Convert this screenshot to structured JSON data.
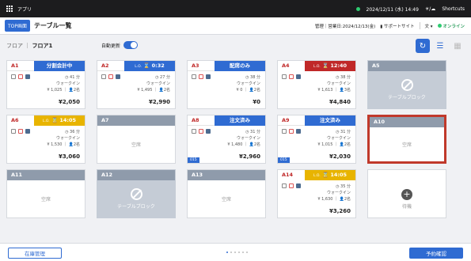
{
  "topbar": {
    "app": "アプリ",
    "datetime": "2024/12/11 (水) 14:49",
    "store": "Shortcuts"
  },
  "header": {
    "top_tag": "TOP画面",
    "title": "テーブル一覧",
    "business_date": "管理｜営業日:2024/12/13(金)",
    "support": "サポートサイト",
    "lang": "文",
    "status": "オンライン"
  },
  "toolbar": {
    "floor_label": "フロア",
    "floor_value": "フロア1",
    "auto_update": "自動更新"
  },
  "cards": [
    {
      "id": "A1",
      "status": "分割会計中",
      "type": "occ",
      "mins": "41",
      "entry": "ウォークイン",
      "sub": "¥ 1,025",
      "guests": "2",
      "total": "¥2,050"
    },
    {
      "id": "A2",
      "status": "0:32",
      "type": "occ",
      "lo": "L.O.",
      "mins": "27",
      "entry": "ウォークイン",
      "sub": "¥ 1,495",
      "guests": "2",
      "total": "¥2,990"
    },
    {
      "id": "A3",
      "status": "配席のみ",
      "type": "occ",
      "mins": "38",
      "entry": "ウォークイン",
      "sub": "¥ 0",
      "guests": "2",
      "total": "¥0"
    },
    {
      "id": "A4",
      "status": "12:40",
      "type": "red",
      "lo": "L.O.",
      "mins": "38",
      "entry": "ウォークイン",
      "sub": "¥ 1,613",
      "guests": "3",
      "total": "¥4,840"
    },
    {
      "id": "A5",
      "type": "block",
      "label": "テーブルブロック"
    },
    {
      "id": "A6",
      "status": "14:05",
      "type": "yel",
      "lo": "L.O.",
      "mins": "36",
      "entry": "ウォークイン",
      "sub": "¥ 1,530",
      "guests": "2",
      "total": "¥3,060"
    },
    {
      "id": "A7",
      "type": "empty",
      "label": "空席"
    },
    {
      "id": "A8",
      "status": "注文済み",
      "type": "occ",
      "mins": "31",
      "entry": "ウォークイン",
      "sub": "¥ 1,480",
      "guests": "2",
      "total": "¥2,960",
      "badge": "015"
    },
    {
      "id": "A9",
      "status": "注文済み",
      "type": "occ",
      "mins": "31",
      "entry": "ウォークイン",
      "sub": "¥ 1,015",
      "guests": "2",
      "total": "¥2,030",
      "badge": "015"
    },
    {
      "id": "A10",
      "type": "empty",
      "label": "空席"
    },
    {
      "id": "A11",
      "type": "empty",
      "label": "空席"
    },
    {
      "id": "A12",
      "type": "block",
      "label": "テーブルブロック"
    },
    {
      "id": "A13",
      "type": "empty",
      "label": "空席"
    },
    {
      "id": "A14",
      "status": "14:05",
      "type": "yel",
      "lo": "L.O.",
      "mins": "35",
      "entry": "ウォークイン",
      "sub": "¥ 1,630",
      "guests": "2",
      "total": "¥3,260"
    },
    {
      "id": "add",
      "type": "add",
      "label": "待機"
    }
  ],
  "units": {
    "mins": "分",
    "guests": "名"
  },
  "footer": {
    "left": "在庫管理",
    "right": "予約確認"
  }
}
